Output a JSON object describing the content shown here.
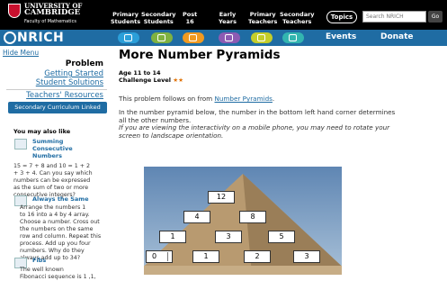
{
  "header": {
    "university": [
      "UNIVERSITY OF",
      "CAMBRIDGE"
    ],
    "faculty": "Faculty of Mathematics",
    "stages": [
      {
        "l1": "Primary",
        "l2": "Students"
      },
      {
        "l1": "Secondary",
        "l2": "Students"
      },
      {
        "l1": "Post",
        "l2": "16"
      },
      {
        "l1": "Early",
        "l2": "Years"
      },
      {
        "l1": "Primary",
        "l2": "Teachers"
      },
      {
        "l1": "Secondary",
        "l2": "Teachers"
      }
    ],
    "topics_label": "Topics",
    "search_placeholder": "Search NRICH",
    "go_label": "Go"
  },
  "nav": {
    "logo": "NRICH",
    "tab_colors": [
      "#2b9fd9",
      "#7fb241",
      "#f19a20",
      "#8c5bb3",
      "#c4ce2a",
      "#33b5b0"
    ],
    "events_label": "Events",
    "donate_label": "Donate"
  },
  "sidebar": {
    "hide_menu": "Hide Menu",
    "problem_heading": "Problem",
    "links": [
      "Getting Started",
      "Student Solutions"
    ],
    "teachers_link": "Teachers' Resources",
    "curriculum_button": "Secondary Curriculum Linked",
    "may_like": "You may also like",
    "related": [
      {
        "title_l1": "Summing",
        "title_l2": "Consecutive",
        "title_l3": "Numbers",
        "text": [
          "15 = 7 + 8 and 10 = 1 + 2",
          "+ 3 + 4. Can you say which",
          "numbers can be expressed",
          "as the sum of two or more",
          "consecutive integers?"
        ]
      },
      {
        "title_l1": "Always the Same",
        "text": [
          "Arrange the numbers 1",
          "to 16 into a 4 by 4 array.",
          "Choose a number. Cross out",
          "the numbers on the same",
          "row and column. Repeat this",
          "process. Add up you four",
          "numbers. Why do they",
          "always add up to 34?"
        ]
      },
      {
        "title_l1": "Fibs",
        "text": [
          "The well known",
          "Fibonacci sequence is 1 ,1,"
        ]
      }
    ]
  },
  "main": {
    "title": "More Number Pyramids",
    "age": "Age 11 to 14",
    "challenge": "Challenge Level",
    "stars": "★★",
    "intro_prefix": "This problem follows on from ",
    "intro_link": "Number Pyramids",
    "intro_suffix": ".",
    "p2_line1": "In the number pyramid below, the number in the bottom left hand corner determines",
    "p2_line2": "all the other numbers.",
    "p3_line1": "If you are viewing the interactivity on a mobile phone, you may need to rotate your",
    "p3_line2": "screen to landscape orientation.",
    "pyramid": {
      "row1": [
        "12"
      ],
      "row2": [
        "4",
        "8"
      ],
      "row3": [
        "1",
        "3",
        "5"
      ],
      "row4": [
        "0",
        "1",
        "2",
        "3"
      ]
    }
  }
}
